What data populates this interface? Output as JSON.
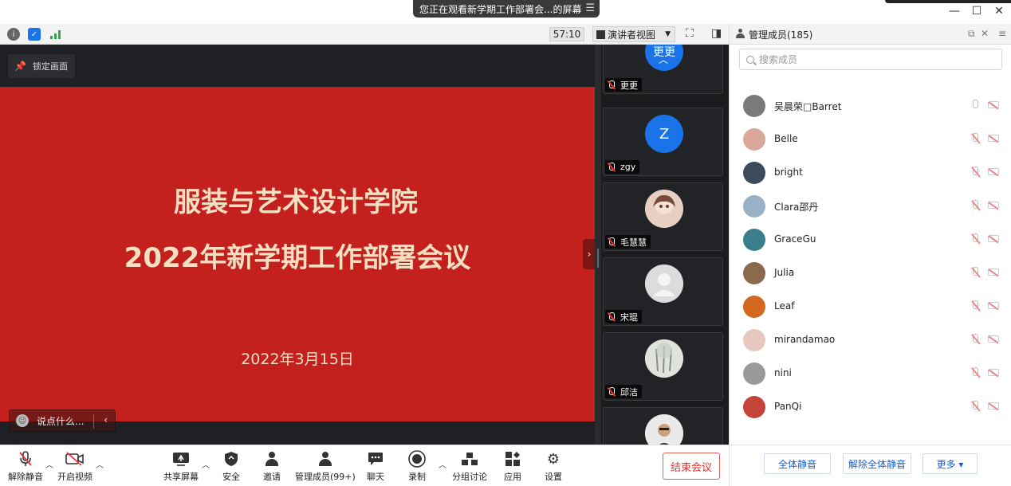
{
  "window": {
    "share_banner": "您正在观看新学期工作部署会...的屏幕",
    "controls": {
      "minimize": "—",
      "maximize": "☐",
      "close": "✕"
    }
  },
  "toolbar": {
    "timer": "57:10",
    "view_mode": "演讲者视图"
  },
  "stage": {
    "lock_label": "锁定画面",
    "slide": {
      "title_line1": "服装与艺术设计学院",
      "title_line2": "2022年新学期工作部署会议",
      "date": "2022年3月15日"
    },
    "chat_placeholder": "说点什么...",
    "collapse_arrow": "›"
  },
  "gallery": {
    "tiles": [
      {
        "name": "更更",
        "initial": "更更",
        "color": "#1a73e8"
      },
      {
        "name": "zgy",
        "initial": "Z",
        "color": "#1a73e8"
      },
      {
        "name": "毛慧慧",
        "initial": "",
        "color": "#c9a79b"
      },
      {
        "name": "宋琨",
        "initial": "",
        "color": "#d9d9d9"
      },
      {
        "name": "邱洁",
        "initial": "",
        "color": "#b9c2b0"
      },
      {
        "name": "",
        "initial": "",
        "color": "#d8d8d8"
      }
    ]
  },
  "panel": {
    "title": "管理成员(185)",
    "search_placeholder": "搜索成员",
    "members": [
      {
        "name": "吴晨荣\u0000Barret",
        "avatar_color": "#7a7a7a",
        "mic_muted": false
      },
      {
        "name": "Belle",
        "avatar_color": "#d9a89a",
        "mic_muted": true
      },
      {
        "name": "bright",
        "avatar_color": "#3d4a5c",
        "mic_muted": true
      },
      {
        "name": "Clara邵丹",
        "avatar_color": "#9ab0c4",
        "mic_muted": true
      },
      {
        "name": "GraceGu",
        "avatar_color": "#3a7d8c",
        "mic_muted": true
      },
      {
        "name": "Julia",
        "avatar_color": "#8a6a4a",
        "mic_muted": true
      },
      {
        "name": "Leaf",
        "avatar_color": "#d2691e",
        "mic_muted": true
      },
      {
        "name": "mirandamao",
        "avatar_color": "#e6c8c0",
        "mic_muted": true
      },
      {
        "name": "nini",
        "avatar_color": "#9a9a9a",
        "mic_muted": true
      },
      {
        "name": "PanQi",
        "avatar_color": "#c4443a",
        "mic_muted": true
      }
    ],
    "footer": {
      "mute_all": "全体静音",
      "unmute_all": "解除全体静音",
      "more": "更多 ▾"
    }
  },
  "controls": {
    "unmute": "解除静音",
    "start_video": "开启视频",
    "share_screen": "共享屏幕",
    "security": "安全",
    "invite": "邀请",
    "manage_members": "管理成员(99+)",
    "chat": "聊天",
    "record": "录制",
    "breakout": "分组讨论",
    "apps": "应用",
    "settings": "设置",
    "end_meeting": "结束会议"
  }
}
